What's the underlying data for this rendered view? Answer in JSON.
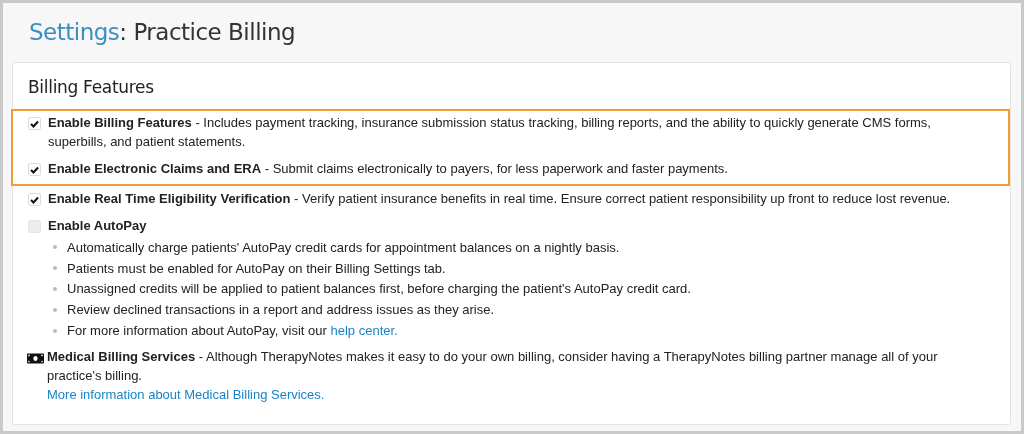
{
  "title": {
    "prefix": "Settings",
    "rest": ": Practice Billing"
  },
  "section": {
    "heading": "Billing Features",
    "options": [
      {
        "kind": "checkbox",
        "checked": true,
        "highlighted": true,
        "text": "**Enable Billing Features** - Includes payment tracking, insurance submission status tracking, billing reports, and the ability to quickly generate CMS forms, superbills, and patient statements."
      },
      {
        "kind": "checkbox",
        "checked": true,
        "highlighted": true,
        "text": "**Enable Electronic Claims and ERA** - Submit claims electronically to payers, for less paperwork and faster payments."
      },
      {
        "kind": "checkbox",
        "checked": true,
        "highlighted": false,
        "text": "**Enable Real Time Eligibility Verification** - Verify patient insurance benefits in real time. Ensure correct patient responsibility up front to reduce lost revenue."
      },
      {
        "kind": "checkbox",
        "checked": false,
        "highlighted": false,
        "text": "**Enable AutoPay**",
        "bullets": [
          {
            "text": "Automatically charge patients' AutoPay credit cards for appointment balances on a nightly basis."
          },
          {
            "text": "Patients must be enabled for AutoPay on their Billing Settings tab."
          },
          {
            "text": "Unassigned credits will be applied to patient balances first, before charging the patient's AutoPay credit card."
          },
          {
            "text": "Review declined transactions in a report and address issues as they arise."
          },
          {
            "text": "For more information about AutoPay, visit our ",
            "link": "help center."
          }
        ]
      },
      {
        "kind": "info",
        "highlighted": false,
        "text": "**Medical Billing Services** - Although TherapyNotes makes it easy to do your own billing, consider having a TherapyNotes billing partner manage all of your practice's billing.",
        "link": "More information about Medical Billing Services."
      }
    ]
  }
}
